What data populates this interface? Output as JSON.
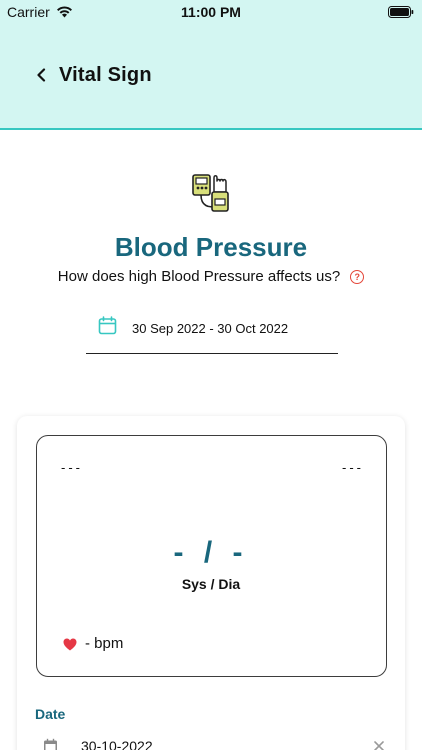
{
  "status_bar": {
    "carrier": "Carrier",
    "time": "11:00 PM"
  },
  "header": {
    "title": "Vital Sign"
  },
  "vital": {
    "title": "Blood Pressure",
    "subtitle": "How does high Blood Pressure affects us?",
    "help_symbol": "?"
  },
  "date_range": {
    "value": "30 Sep 2022 - 30 Oct 2022"
  },
  "reading": {
    "left_label": "---",
    "right_label": "---",
    "value": "- / -",
    "unit_label": "Sys / Dia",
    "heart_rate": "- bpm"
  },
  "date_section": {
    "label": "Date",
    "value": "30-10-2022"
  },
  "colors": {
    "header_bg": "#d3f6f2",
    "header_border": "#37c7c1",
    "title_teal": "#19677d",
    "heart_red": "#e53845",
    "help_red": "#e4473a"
  },
  "icons": {
    "back": "chevron-left-icon",
    "wifi": "wifi-icon",
    "battery": "battery-icon",
    "bp": "blood-pressure-monitor-icon",
    "help": "question-circle-icon",
    "calendar": "calendar-icon",
    "heart": "heart-icon",
    "clear": "close-icon"
  }
}
